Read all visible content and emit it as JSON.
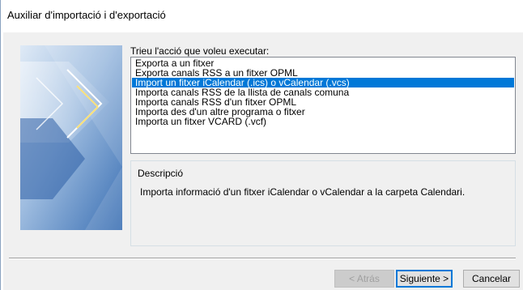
{
  "window": {
    "title": "Auxiliar d'importació i d'exportació"
  },
  "prompt": "Trieu l'acció que voleu executar:",
  "actions": [
    {
      "label": "Exporta a un fitxer",
      "selected": false
    },
    {
      "label": "Exporta canals RSS a un fitxer OPML",
      "selected": false
    },
    {
      "label": "Import un fitxer iCalendar (.ics) o vCalendar (.vcs)",
      "selected": true
    },
    {
      "label": "Importa canals RSS de la llista de canals comuna",
      "selected": false
    },
    {
      "label": "Importa canals RSS d'un fitxer OPML",
      "selected": false
    },
    {
      "label": "Importa des d'un altre programa o fitxer",
      "selected": false
    },
    {
      "label": "Importa un fitxer VCARD (.vcf)",
      "selected": false
    }
  ],
  "description": {
    "title": "Descripció",
    "text": "Importa informació d'un fitxer iCalendar o vCalendar a la carpeta Calendari."
  },
  "buttons": {
    "back": "< Atrás",
    "next": "Siguiente >",
    "cancel": "Cancelar"
  },
  "colors": {
    "selection": "#0078d7",
    "dialog_background": "#f0f0f0"
  }
}
